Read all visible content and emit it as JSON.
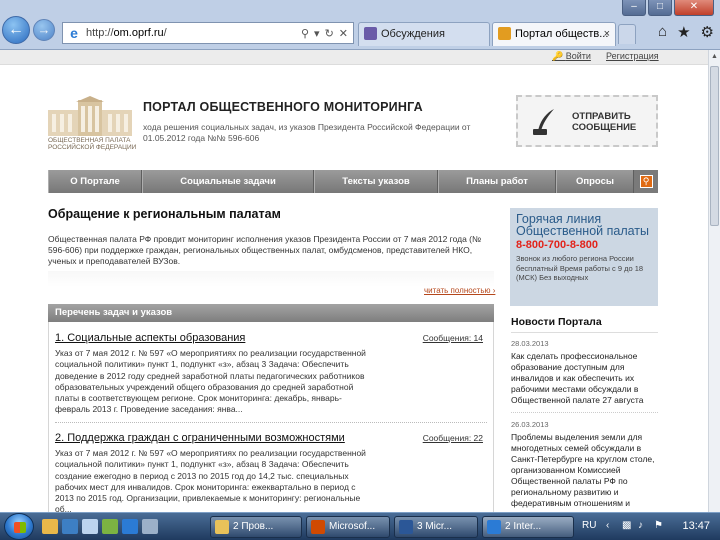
{
  "browser": {
    "url_prefix": "http://",
    "url_host": "om.oprf.ru",
    "url_suffix": "/",
    "tabs": [
      {
        "label": "Обсуждения"
      },
      {
        "label": "Портал обществ..."
      }
    ],
    "icons": [
      "back-arrow-icon",
      "forward-arrow-icon",
      "ie-logo-icon",
      "search-icon",
      "refresh-icon",
      "stop-icon",
      "home-icon",
      "favorites-star-icon",
      "tools-gear-icon"
    ]
  },
  "topbar": {
    "login": "Войти",
    "register": "Регистрация"
  },
  "header": {
    "logo_caption": "ОБЩЕСТВЕННАЯ ПАЛАТА РОССИЙСКОЙ ФЕДЕРАЦИИ",
    "title": "ПОРТАЛ ОБЩЕСТВЕННОГО МОНИТОРИНГА",
    "subtitle": "хода решения социальных задач, из указов Президента Российской Федерации от 01.05.2012 года №№ 596-606",
    "send_message": "ОТПРАВИТЬ СООБЩЕНИЕ"
  },
  "menu": {
    "items": [
      "О Портале",
      "Социальные задачи",
      "Тексты указов",
      "Планы работ",
      "Опросы"
    ]
  },
  "appeal": {
    "title": "Обращение к региональным палатам",
    "text": "Общественная палата РФ провдит мониторинг исполнения указов Президента России от 7 мая 2012 года (№ 596-606) при поддержке граждан, региональных общественных палат, омбудсменов, представителей НКО, ученых и преподавателей ВУЗов.",
    "read_all": "читать полностью"
  },
  "tasks": {
    "header": "Перечень задач и указов",
    "items": [
      {
        "title": "1. Социальные аспекты образования",
        "count": "Сообщения: 14",
        "text": "Указ от 7 мая 2012 г. № 597 «О мероприятиях по реализации государственной социальной политики» пункт 1, подпункт «з», абзац 3 Задача: Обеспечить доведение в 2012 году средней заработной платы педагогических работников образовательных учреждений общего образования до средней заработной платы в соответствующем регионе. Срок мониторинга: декабрь, январь-февраль 2013 г. Проведение заседания: янва..."
      },
      {
        "title": "2. Поддержка граждан с ограниченными возможностями",
        "count": "Сообщения: 22",
        "text": "Указ от 7 мая 2012 г. № 597 «О мероприятиях по реализации государственной социальной политики» пункт 1, подпункт «з», абзац 8 Задача: Обеспечить создание ежегодно в период с 2013 по 2015 год до 14,2 тыс. специальных рабочих мест для инвалидов. Срок мониторинга: ежеквартально в период с 2013 по 2015 год. Организации, привлекаемые к мониторингу: региональные об..."
      }
    ]
  },
  "hotline": {
    "title": "Горячая линия Общественной палаты",
    "phone": "8-800-700-8-800",
    "details": "Звонок из любого региона России бесплатный Время работы с 9 до 18 (МСК) Без выходных"
  },
  "news": {
    "title": "Новости Портала",
    "items": [
      {
        "date": "28.03.2013",
        "text": "Как сделать профессиональное образование доступным для инвалидов и как обеспечить их рабочими местами обсуждали в Общественной палате 27 августа"
      },
      {
        "date": "26.03.2013",
        "text": "Проблемы выделения земли для многодетных семей обсуждали в Санкт-Петербурге на круглом столе, организованном Комиссией Общественной палаты РФ по региональному развитию и федеративным отношениям и"
      }
    ]
  },
  "taskbar": {
    "buttons": [
      "2 Пров...",
      "Microsof...",
      "3 Micr...",
      "2 Inter..."
    ],
    "lang": "RU",
    "time": "13:47"
  },
  "colors": {
    "accent_orange": "#e06a12",
    "hotline_phone": "#e2231a",
    "hotline_bg": "#ccd7e3",
    "menu_gray": "#8a8a8a"
  }
}
